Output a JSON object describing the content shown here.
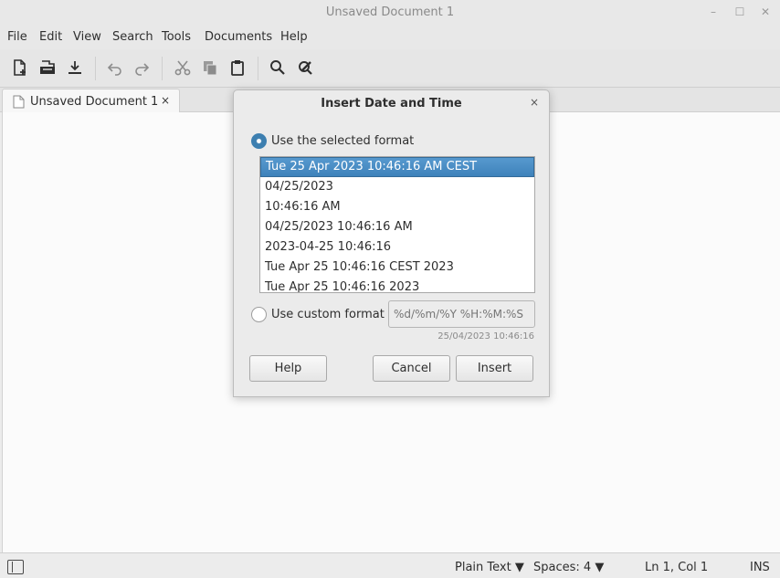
{
  "window": {
    "title": "Unsaved Document 1",
    "controls": {
      "minimize": "–",
      "maximize": "☐",
      "close": "✕"
    }
  },
  "menu": [
    "File",
    "Edit",
    "View",
    "Search",
    "Tools",
    "Documents",
    "Help"
  ],
  "toolbar": {
    "icons": [
      "new-document-icon",
      "open-icon",
      "save-icon",
      "undo-icon",
      "redo-icon",
      "cut-icon",
      "copy-icon",
      "paste-icon",
      "search-icon",
      "tools-icon"
    ]
  },
  "tab": {
    "label": "Unsaved Document 1",
    "close": "×"
  },
  "dialog": {
    "title": "Insert Date and Time",
    "close": "×",
    "option_selected_format": "Use the selected format",
    "formats": [
      "Tue 25 Apr 2023 10:46:16 AM CEST",
      "04/25/2023",
      "10:46:16 AM",
      "04/25/2023 10:46:16 AM",
      "2023-04-25 10:46:16",
      "Tue Apr 25 10:46:16 CEST 2023",
      "Tue Apr 25 10:46:16 2023"
    ],
    "selected_index": 0,
    "option_custom_format": "Use custom format",
    "custom_placeholder": "%d/%m/%Y %H:%M:%S",
    "preview": "25/04/2023 10:46:16",
    "buttons": {
      "help": "Help",
      "cancel": "Cancel",
      "insert": "Insert"
    }
  },
  "statusbar": {
    "language": "Plain Text",
    "spaces": "Spaces: 4",
    "position": "Ln 1, Col 1",
    "mode": "INS"
  },
  "colors": {
    "accent": "#3e82bb",
    "editor_bg": "#fbfbfb",
    "window_bg": "#ececec"
  }
}
